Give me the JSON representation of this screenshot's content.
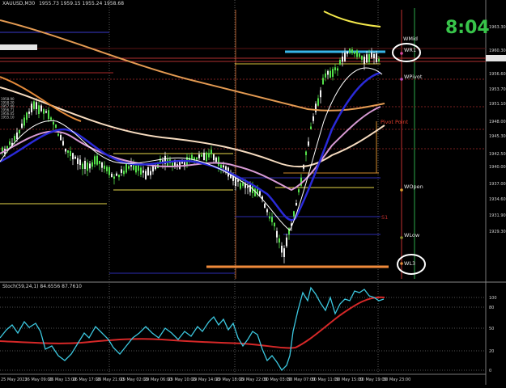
{
  "chart_header": "XAUUSD,M30",
  "chart_ohlc": "1955.73 1959.15 1955.24 1958.68",
  "clock": "8:04",
  "pivot_labels": {
    "wmid": "WMid",
    "wr1": "WR1",
    "wpivot": "WPivot",
    "pivot_point": "Pivot Point",
    "wopen": "WOpen",
    "wlow": "WLow",
    "wl3": "WL3",
    "s1": "S1"
  },
  "price_axis": [
    "1963.30",
    "1960.30",
    "1958.68",
    "1956.60",
    "1953.70",
    "1951.10",
    "1948.00",
    "1945.30",
    "1942.50",
    "1940.00",
    "1937.00",
    "1934.60",
    "1931.90",
    "1929.30"
  ],
  "stoch_header": "Stoch(59,24,1) 84.6556 87.7610",
  "stoch_axis": [
    "100",
    "80",
    "50",
    "20",
    "0"
  ],
  "time_axis": [
    "25 May 2023",
    "26 May 09:00",
    "26 May 13:00",
    "26 May 17:00",
    "26 May 21:00",
    "29 May 02:00",
    "29 May 06:00",
    "29 May 10:00",
    "29 May 14:00",
    "29 May 18:00",
    "29 May 22:00",
    "30 May 03:00",
    "30 May 07:00",
    "30 May 11:00",
    "30 May 15:00",
    "30 May 19:00",
    "30 May 23:00"
  ],
  "left_stacked_labels": [
    "1958.90",
    "1958.20",
    "1957.40",
    "1956.71",
    "1956.05",
    "1955.10"
  ],
  "colors": {
    "bull": "#54e04a",
    "bear": "#f2f2f2",
    "ma_yellow": "#f3e84b",
    "ma_orange": "#e39a52",
    "ma_cream": "#f6dcc0",
    "ma_pink": "#d79ad4",
    "ma_blue": "#2a2ad8",
    "ma_white": "#ffffff",
    "stoch_main": "#3cc8e0",
    "stoch_signal": "#d62828",
    "highlight_blue": "#38b6e8",
    "highlight_orange": "#ef8a3a"
  }
}
